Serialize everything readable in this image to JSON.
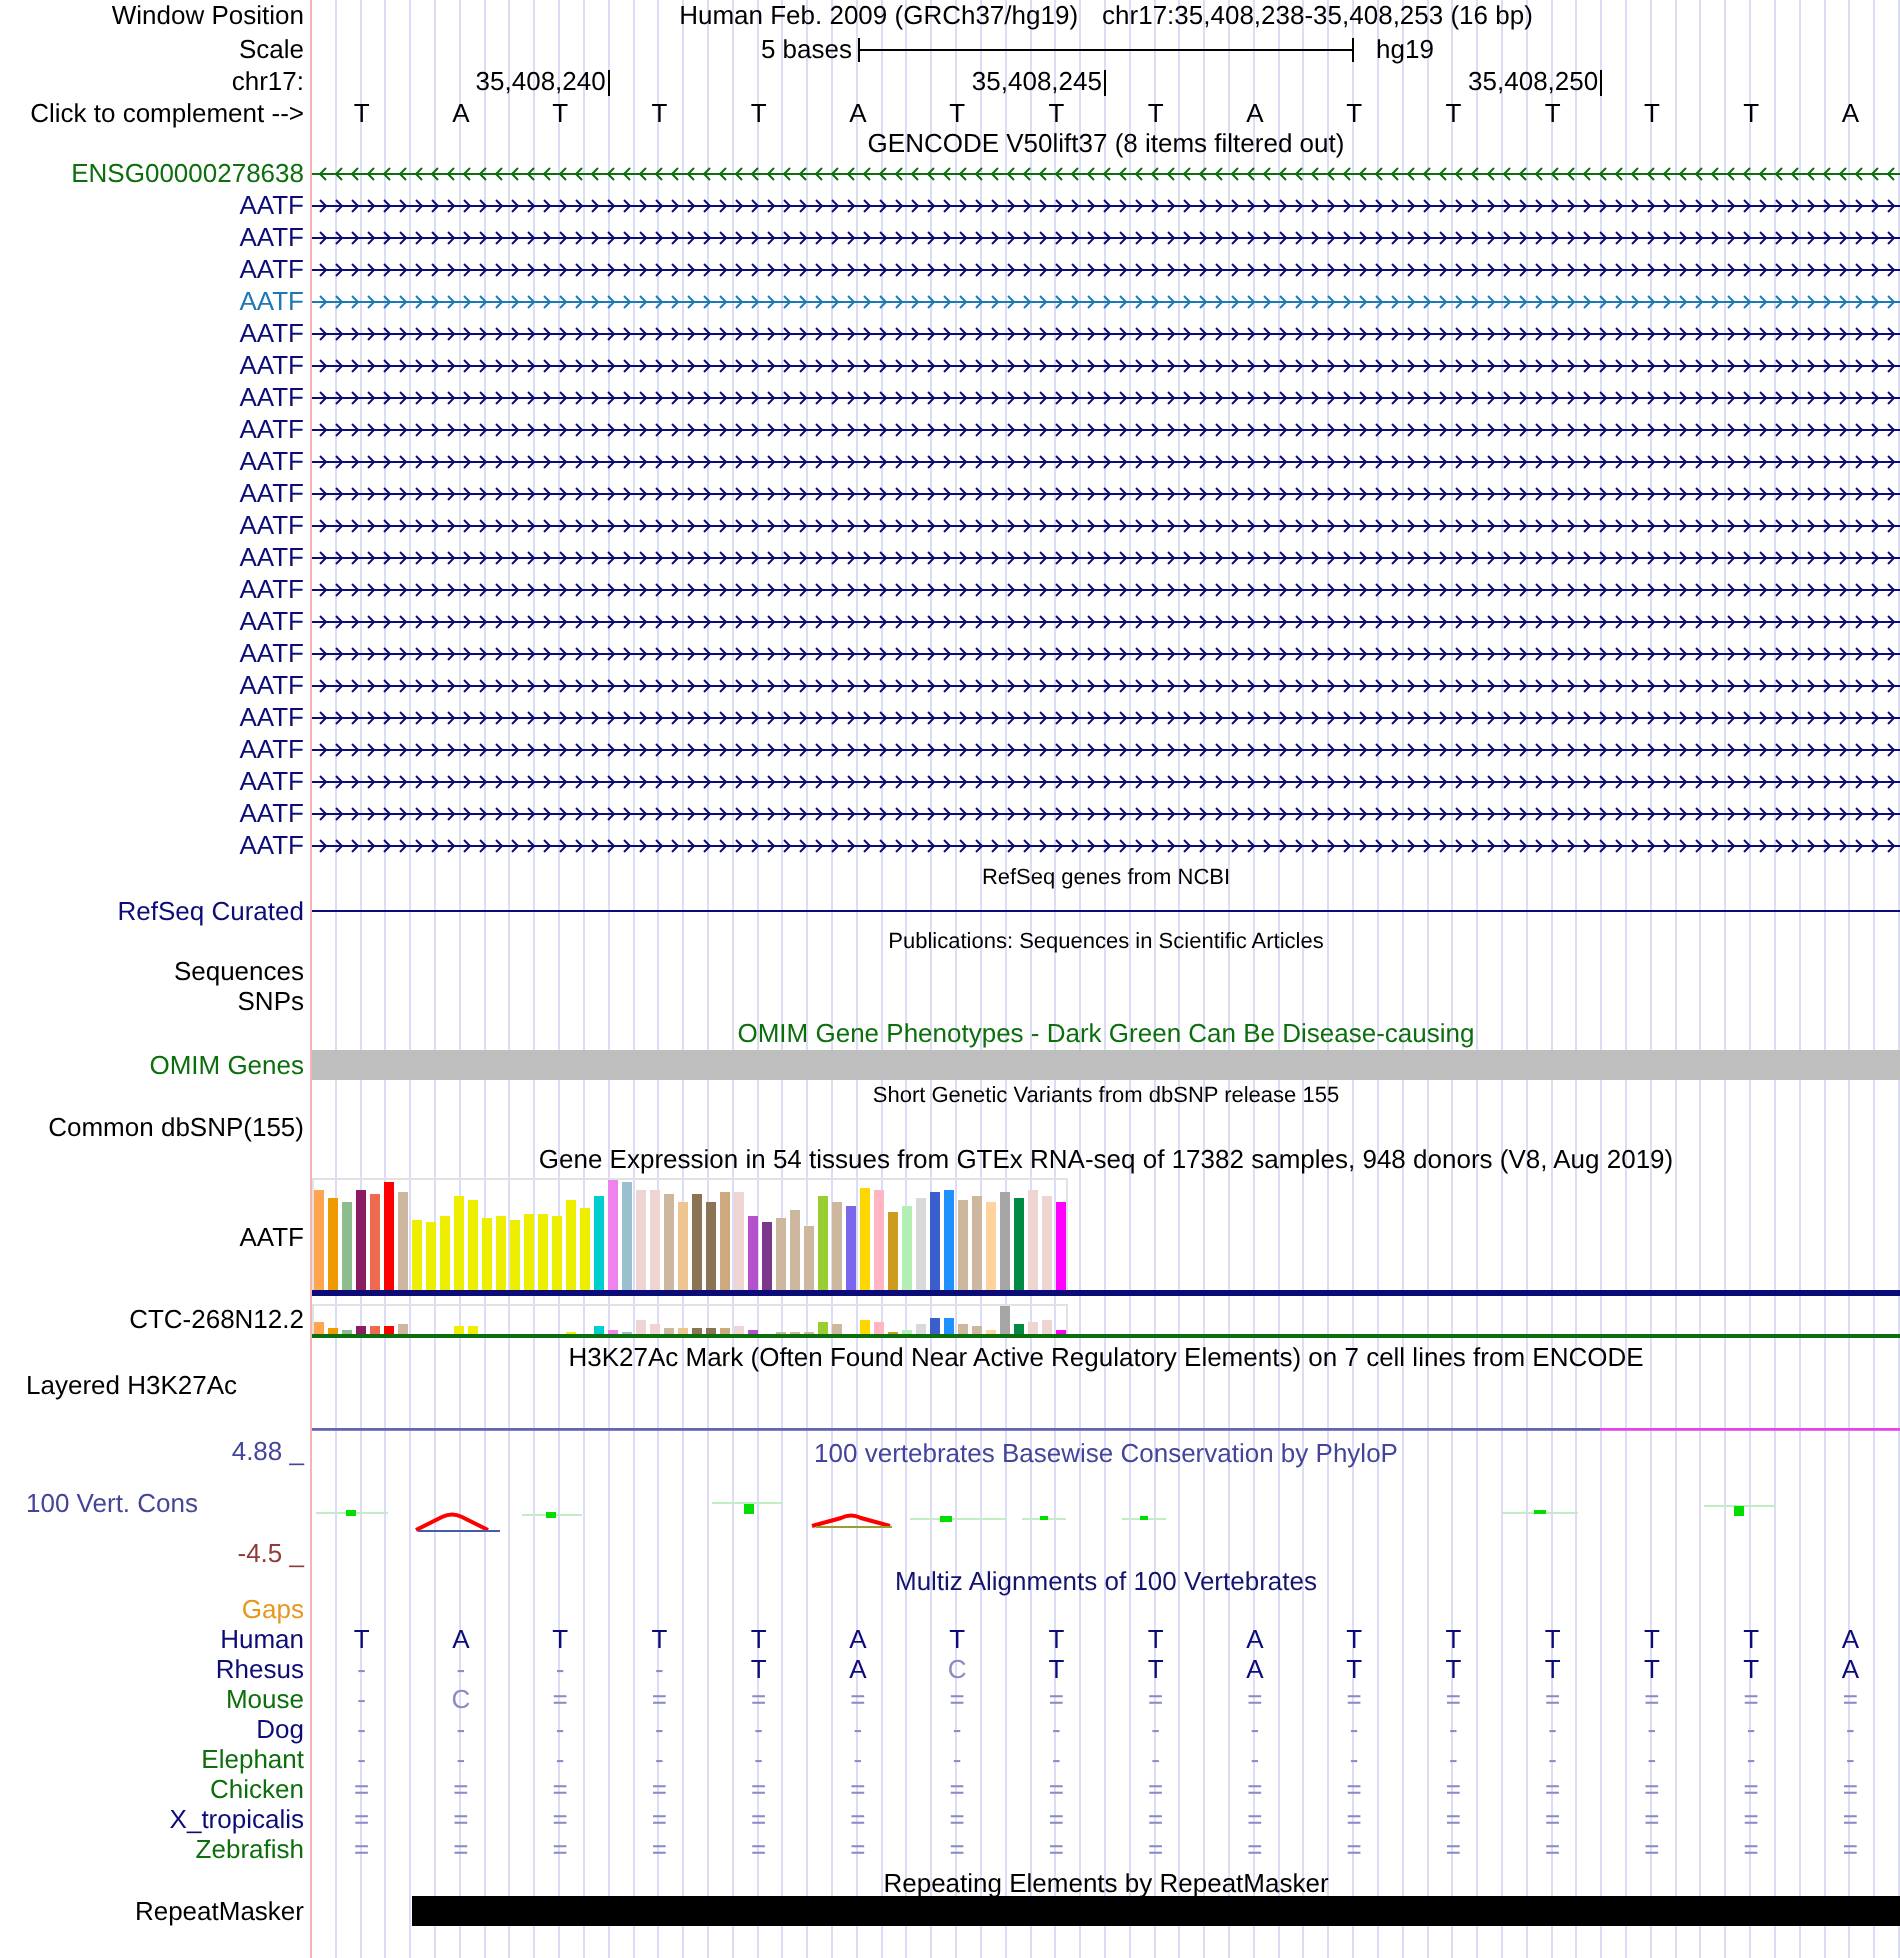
{
  "header": {
    "position_label": "Window Position",
    "assembly": "Human Feb. 2009 (GRCh37/hg19)",
    "position": "chr17:35,408,238-35,408,253 (16 bp)",
    "scale_label": "Scale",
    "scale_text": "5 bases",
    "scale_assembly": "hg19",
    "chrom_label": "chr17:",
    "ruler_ticks": [
      "35,408,240",
      "35,408,245",
      "35,408,250"
    ],
    "complement_label": "Click to complement -->",
    "bases": [
      "T",
      "A",
      "T",
      "T",
      "T",
      "A",
      "T",
      "T",
      "T",
      "A",
      "T",
      "T",
      "T",
      "T",
      "T",
      "A"
    ]
  },
  "gencode": {
    "title": "GENCODE V50lift37 (8 items filtered out)",
    "transcripts": [
      {
        "label": "ENSG00000278638",
        "color": "#0c6e0c",
        "reverse": true
      },
      {
        "label": "AATF",
        "color": "#0c0c78",
        "reverse": false
      },
      {
        "label": "AATF",
        "color": "#0c0c78",
        "reverse": false
      },
      {
        "label": "AATF",
        "color": "#0c0c78",
        "reverse": false
      },
      {
        "label": "AATF",
        "color": "#1e78b4",
        "reverse": false
      },
      {
        "label": "AATF",
        "color": "#0c0c78",
        "reverse": false
      },
      {
        "label": "AATF",
        "color": "#0c0c78",
        "reverse": false
      },
      {
        "label": "AATF",
        "color": "#0c0c78",
        "reverse": false
      },
      {
        "label": "AATF",
        "color": "#0c0c78",
        "reverse": false
      },
      {
        "label": "AATF",
        "color": "#0c0c78",
        "reverse": false
      },
      {
        "label": "AATF",
        "color": "#0c0c78",
        "reverse": false
      },
      {
        "label": "AATF",
        "color": "#0c0c78",
        "reverse": false
      },
      {
        "label": "AATF",
        "color": "#0c0c78",
        "reverse": false
      },
      {
        "label": "AATF",
        "color": "#0c0c78",
        "reverse": false
      },
      {
        "label": "AATF",
        "color": "#0c0c78",
        "reverse": false
      },
      {
        "label": "AATF",
        "color": "#0c0c78",
        "reverse": false
      },
      {
        "label": "AATF",
        "color": "#0c0c78",
        "reverse": false
      },
      {
        "label": "AATF",
        "color": "#0c0c78",
        "reverse": false
      },
      {
        "label": "AATF",
        "color": "#0c0c78",
        "reverse": false
      },
      {
        "label": "AATF",
        "color": "#0c0c78",
        "reverse": false
      },
      {
        "label": "AATF",
        "color": "#0c0c78",
        "reverse": false
      },
      {
        "label": "AATF",
        "color": "#0c0c78",
        "reverse": false
      }
    ]
  },
  "refseq": {
    "title": "RefSeq genes from NCBI",
    "label": "RefSeq Curated"
  },
  "publications": {
    "title": "Publications: Sequences in Scientific Articles",
    "labels": [
      "Sequences",
      "SNPs"
    ]
  },
  "omim": {
    "title": "OMIM Gene Phenotypes - Dark Green Can Be Disease-causing",
    "label": "OMIM Genes"
  },
  "dbsnp": {
    "title": "Short Genetic Variants from dbSNP release 155",
    "label": "Common dbSNP(155)"
  },
  "gtex": {
    "title": "Gene Expression in 54 tissues from GTEx RNA-seq of 17382 samples, 948 donors (V8, Aug 2019)",
    "genes": [
      {
        "label": "AATF",
        "color": "#0c0c78"
      },
      {
        "label": "CTC-268N12.2",
        "color": "#0c6e0c"
      }
    ]
  },
  "h3k27ac": {
    "title": "H3K27Ac Mark (Often Found Near Active Regulatory Elements) on 7 cell lines from ENCODE",
    "label": "Layered H3K27Ac"
  },
  "conservation": {
    "title": "100 vertebrates Basewise Conservation by PhyloP",
    "label": "100 Vert. Cons",
    "top_label": "4.88 _",
    "bottom_label": "-4.5 _"
  },
  "multiz": {
    "title": "Multiz Alignments of 100 Vertebrates",
    "gaps_label": "Gaps",
    "species": [
      {
        "name": "Human",
        "color": "#0c0c78",
        "bases": [
          {
            "text": "T",
            "faded": false
          },
          {
            "text": "A",
            "faded": false
          },
          {
            "text": "T",
            "faded": false
          },
          {
            "text": "T",
            "faded": false
          },
          {
            "text": "T",
            "faded": false
          },
          {
            "text": "A",
            "faded": false
          },
          {
            "text": "T",
            "faded": false
          },
          {
            "text": "T",
            "faded": false
          },
          {
            "text": "T",
            "faded": false
          },
          {
            "text": "A",
            "faded": false
          },
          {
            "text": "T",
            "faded": false
          },
          {
            "text": "T",
            "faded": false
          },
          {
            "text": "T",
            "faded": false
          },
          {
            "text": "T",
            "faded": false
          },
          {
            "text": "T",
            "faded": false
          },
          {
            "text": "A",
            "faded": false
          }
        ]
      },
      {
        "name": "Rhesus",
        "color": "#0c0c78",
        "bases": [
          {
            "text": "-",
            "faded": true
          },
          {
            "text": "-",
            "faded": true
          },
          {
            "text": "-",
            "faded": true
          },
          {
            "text": "-",
            "faded": true
          },
          {
            "text": "T",
            "faded": false
          },
          {
            "text": "A",
            "faded": false
          },
          {
            "text": "C",
            "faded": true
          },
          {
            "text": "T",
            "faded": false
          },
          {
            "text": "T",
            "faded": false
          },
          {
            "text": "A",
            "faded": false
          },
          {
            "text": "T",
            "faded": false
          },
          {
            "text": "T",
            "faded": false
          },
          {
            "text": "T",
            "faded": false
          },
          {
            "text": "T",
            "faded": false
          },
          {
            "text": "T",
            "faded": false
          },
          {
            "text": "A",
            "faded": false
          }
        ]
      },
      {
        "name": "Mouse",
        "color": "#0c6e0c",
        "bases": [
          {
            "text": "-",
            "faded": true
          },
          {
            "text": "C",
            "faded": true
          },
          {
            "text": "=",
            "faded": true
          },
          {
            "text": "=",
            "faded": true
          },
          {
            "text": "=",
            "faded": true
          },
          {
            "text": "=",
            "faded": true
          },
          {
            "text": "=",
            "faded": true
          },
          {
            "text": "=",
            "faded": true
          },
          {
            "text": "=",
            "faded": true
          },
          {
            "text": "=",
            "faded": true
          },
          {
            "text": "=",
            "faded": true
          },
          {
            "text": "=",
            "faded": true
          },
          {
            "text": "=",
            "faded": true
          },
          {
            "text": "=",
            "faded": true
          },
          {
            "text": "=",
            "faded": true
          },
          {
            "text": "=",
            "faded": true
          }
        ]
      },
      {
        "name": "Dog",
        "color": "#0c0c78",
        "bases": [
          {
            "text": "-",
            "faded": true
          },
          {
            "text": "-",
            "faded": true
          },
          {
            "text": "-",
            "faded": true
          },
          {
            "text": "-",
            "faded": true
          },
          {
            "text": "-",
            "faded": true
          },
          {
            "text": "-",
            "faded": true
          },
          {
            "text": "-",
            "faded": true
          },
          {
            "text": "-",
            "faded": true
          },
          {
            "text": "-",
            "faded": true
          },
          {
            "text": "-",
            "faded": true
          },
          {
            "text": "-",
            "faded": true
          },
          {
            "text": "-",
            "faded": true
          },
          {
            "text": "-",
            "faded": true
          },
          {
            "text": "-",
            "faded": true
          },
          {
            "text": "-",
            "faded": true
          },
          {
            "text": "-",
            "faded": true
          }
        ]
      },
      {
        "name": "Elephant",
        "color": "#0c6e0c",
        "bases": [
          {
            "text": "-",
            "faded": true
          },
          {
            "text": "-",
            "faded": true
          },
          {
            "text": "-",
            "faded": true
          },
          {
            "text": "-",
            "faded": true
          },
          {
            "text": "-",
            "faded": true
          },
          {
            "text": "-",
            "faded": true
          },
          {
            "text": "-",
            "faded": true
          },
          {
            "text": "-",
            "faded": true
          },
          {
            "text": "-",
            "faded": true
          },
          {
            "text": "-",
            "faded": true
          },
          {
            "text": "-",
            "faded": true
          },
          {
            "text": "-",
            "faded": true
          },
          {
            "text": "-",
            "faded": true
          },
          {
            "text": "-",
            "faded": true
          },
          {
            "text": "-",
            "faded": true
          },
          {
            "text": "-",
            "faded": true
          }
        ]
      },
      {
        "name": "Chicken",
        "color": "#0c6e0c",
        "bases": [
          {
            "text": "=",
            "faded": true
          },
          {
            "text": "=",
            "faded": true
          },
          {
            "text": "=",
            "faded": true
          },
          {
            "text": "=",
            "faded": true
          },
          {
            "text": "=",
            "faded": true
          },
          {
            "text": "=",
            "faded": true
          },
          {
            "text": "=",
            "faded": true
          },
          {
            "text": "=",
            "faded": true
          },
          {
            "text": "=",
            "faded": true
          },
          {
            "text": "=",
            "faded": true
          },
          {
            "text": "=",
            "faded": true
          },
          {
            "text": "=",
            "faded": true
          },
          {
            "text": "=",
            "faded": true
          },
          {
            "text": "=",
            "faded": true
          },
          {
            "text": "=",
            "faded": true
          },
          {
            "text": "=",
            "faded": true
          }
        ]
      },
      {
        "name": "X_tropicalis",
        "color": "#0c0c78",
        "bases": [
          {
            "text": "=",
            "faded": true
          },
          {
            "text": "=",
            "faded": true
          },
          {
            "text": "=",
            "faded": true
          },
          {
            "text": "=",
            "faded": true
          },
          {
            "text": "=",
            "faded": true
          },
          {
            "text": "=",
            "faded": true
          },
          {
            "text": "=",
            "faded": true
          },
          {
            "text": "=",
            "faded": true
          },
          {
            "text": "=",
            "faded": true
          },
          {
            "text": "=",
            "faded": true
          },
          {
            "text": "=",
            "faded": true
          },
          {
            "text": "=",
            "faded": true
          },
          {
            "text": "=",
            "faded": true
          },
          {
            "text": "=",
            "faded": true
          },
          {
            "text": "=",
            "faded": true
          },
          {
            "text": "=",
            "faded": true
          }
        ]
      },
      {
        "name": "Zebrafish",
        "color": "#0c6e0c",
        "bases": [
          {
            "text": "=",
            "faded": true
          },
          {
            "text": "=",
            "faded": true
          },
          {
            "text": "=",
            "faded": true
          },
          {
            "text": "=",
            "faded": true
          },
          {
            "text": "=",
            "faded": true
          },
          {
            "text": "=",
            "faded": true
          },
          {
            "text": "=",
            "faded": true
          },
          {
            "text": "=",
            "faded": true
          },
          {
            "text": "=",
            "faded": true
          },
          {
            "text": "=",
            "faded": true
          },
          {
            "text": "=",
            "faded": true
          },
          {
            "text": "=",
            "faded": true
          },
          {
            "text": "=",
            "faded": true
          },
          {
            "text": "=",
            "faded": true
          },
          {
            "text": "=",
            "faded": true
          },
          {
            "text": "=",
            "faded": true
          }
        ]
      }
    ]
  },
  "repeatmasker": {
    "title": "Repeating Elements by RepeatMasker",
    "label": "RepeatMasker"
  }
}
